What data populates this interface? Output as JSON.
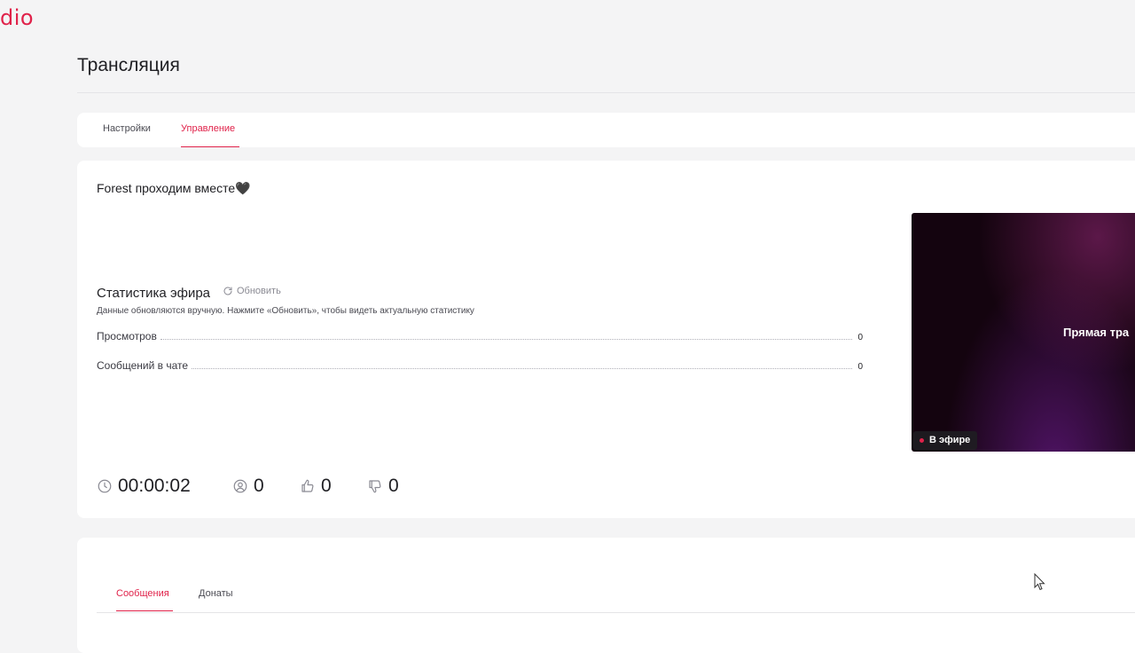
{
  "brand": {
    "logo_text": "dio",
    "color": "#e0224a"
  },
  "page": {
    "title": "Трансляция"
  },
  "top_tabs": [
    {
      "label": "Настройки",
      "active": false
    },
    {
      "label": "Управление",
      "active": true
    }
  ],
  "stream": {
    "title": "Forest проходим вместе🖤",
    "stats": {
      "title": "Статистика эфира",
      "refresh_label": "Обновить",
      "hint": "Данные обновляются вручную. Нажмите «Обновить», чтобы видеть актуальную статистику",
      "rows": [
        {
          "label": "Просмотров",
          "value": "0"
        },
        {
          "label": "Сообщений в чате",
          "value": "0"
        }
      ]
    },
    "live": {
      "duration": "00:00:02",
      "viewers": "0",
      "likes": "0",
      "dislikes": "0"
    },
    "preview": {
      "overlay_text": "Прямая тра",
      "badge": "В эфире"
    }
  },
  "chat_tabs": [
    {
      "label": "Сообщения",
      "active": true
    },
    {
      "label": "Донаты",
      "active": false
    }
  ],
  "icons": {
    "refresh": "refresh-icon",
    "clock": "clock-icon",
    "viewers": "user-circle-icon",
    "like": "thumbs-up-icon",
    "dislike": "thumbs-down-icon"
  }
}
